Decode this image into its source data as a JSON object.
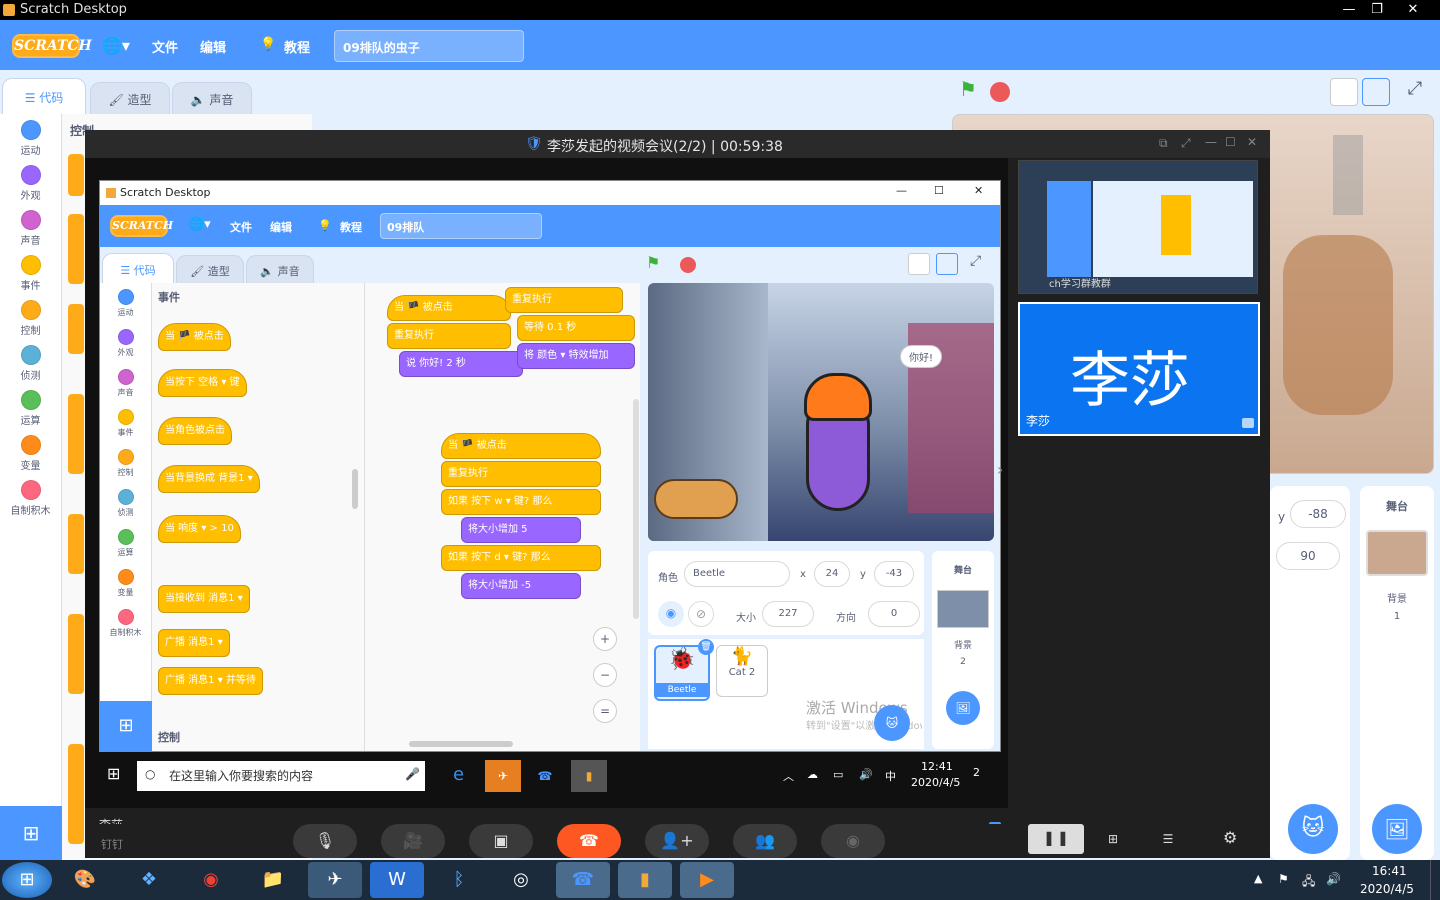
{
  "window": {
    "title": "Scratch Desktop"
  },
  "scratch": {
    "logo": "SCRATCH",
    "menu": {
      "file": "文件",
      "edit": "编辑",
      "tutorials": "教程"
    },
    "project_title": "09排队的虫子",
    "tabs": {
      "code": "代码",
      "costumes": "造型",
      "sounds": "声音"
    },
    "categories": [
      {
        "label": "运动",
        "color": "#4c97ff"
      },
      {
        "label": "外观",
        "color": "#9966ff"
      },
      {
        "label": "声音",
        "color": "#cf63cf"
      },
      {
        "label": "事件",
        "color": "#ffbf00"
      },
      {
        "label": "控制",
        "color": "#ffab19"
      },
      {
        "label": "侦测",
        "color": "#5cb1d6"
      },
      {
        "label": "运算",
        "color": "#59c059"
      },
      {
        "label": "变量",
        "color": "#ff8c1a"
      },
      {
        "label": "自制积木",
        "color": "#ff6680"
      }
    ],
    "palette_heading": "控制",
    "sprite_info": {
      "y_label": "y",
      "y_value": "-88",
      "direction_value": "90"
    },
    "stage_panel": {
      "label": "舞台",
      "backdrop_label": "背景",
      "backdrop_count": "1"
    }
  },
  "meeting": {
    "title": "李莎发起的视频会议(2/2) | 00:59:38",
    "participant_name": "李莎",
    "participant_tag": "李莎",
    "thumb_caption": "ch学习群教群",
    "shared_label": "李莎",
    "brand": "钉钉"
  },
  "shared": {
    "title": "Scratch Desktop",
    "menu": {
      "file": "文件",
      "edit": "编辑",
      "tutorials": "教程"
    },
    "project_title": "09排队",
    "tabs": {
      "code": "代码",
      "costumes": "造型",
      "sounds": "声音"
    },
    "categories": [
      {
        "label": "运动",
        "color": "#4c97ff"
      },
      {
        "label": "外观",
        "color": "#9966ff"
      },
      {
        "label": "声音",
        "color": "#cf63cf"
      },
      {
        "label": "事件",
        "color": "#ffbf00"
      },
      {
        "label": "控制",
        "color": "#ffab19"
      },
      {
        "label": "侦测",
        "color": "#5cb1d6"
      },
      {
        "label": "运算",
        "color": "#59c059"
      },
      {
        "label": "变量",
        "color": "#ff8c1a"
      },
      {
        "label": "自制积木",
        "color": "#ff6680"
      }
    ],
    "palette_heading": "事件",
    "palette_footer": "控制",
    "palette_blocks": [
      "当 🏴 被点击",
      "当按下 空格 ▾ 键",
      "当角色被点击",
      "当背景换成 背景1 ▾",
      "当 响度 ▾ > 10",
      "当接收到 消息1 ▾",
      "广播 消息1 ▾",
      "广播 消息1 ▾ 并等待"
    ],
    "scripts": {
      "s1": [
        "当 🏴 被点击",
        "重复执行",
        "说 你好! 2 秒"
      ],
      "s2": [
        "重复执行",
        "等待 0.1 秒",
        "将 颜色 ▾ 特效增加"
      ],
      "s3": [
        "当 🏴 被点击",
        "重复执行",
        "如果 按下 w ▾ 键? 那么",
        "将大小增加 5",
        "如果 按下 d ▾ 键? 那么",
        "将大小增加 -5"
      ]
    },
    "speech_bubble": "你好!",
    "sprite": {
      "label": "角色",
      "name": "Beetle",
      "x_label": "x",
      "x": "24",
      "y_label": "y",
      "y": "-43",
      "size_label": "大小",
      "size": "227",
      "direction_label": "方向",
      "direction": "0"
    },
    "sprites": [
      {
        "name": "Beetle"
      },
      {
        "name": "Cat 2"
      }
    ],
    "stage_panel": {
      "label": "舞台",
      "backdrop_label": "背景",
      "backdrop_count": "2"
    },
    "watermark1": "激活 Windows",
    "watermark2": "转到\"设置\"以激活 Windows。",
    "taskbar": {
      "search": "在这里输入你要搜索的内容",
      "time": "12:41",
      "date": "2020/4/5",
      "ime": "中",
      "notif": "2"
    }
  },
  "taskbar": {
    "time": "16:41",
    "date": "2020/4/5"
  }
}
